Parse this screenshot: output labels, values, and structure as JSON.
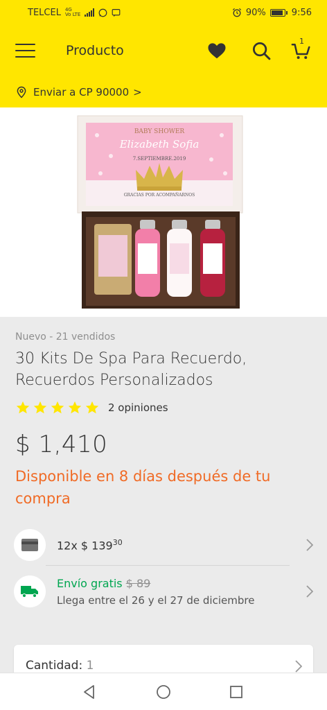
{
  "status_bar": {
    "carrier": "TELCEL",
    "network_top": "Vo LTE",
    "network_gen": "4G",
    "battery": "90%",
    "time": "9:56",
    "icons": [
      "signal-bars",
      "whatsapp",
      "chat",
      "alarm-clock",
      "battery"
    ]
  },
  "app_bar": {
    "title": "Producto",
    "cart_count": "1",
    "icons": [
      "menu-icon",
      "heart-icon",
      "search-icon",
      "cart-icon"
    ]
  },
  "shipping_bar": {
    "label": "Enviar a CP 90000",
    "chevron": ">"
  },
  "product": {
    "condition": "Nuevo - 21 vendidos",
    "title": "30 Kits De Spa Para Recuerdo, Recuerdos Personalizados",
    "rating": 5,
    "rating_max": 5,
    "reviews": "2 opiniones",
    "price": "$ 1,410",
    "availability": "Disponible en 8 días después de tu compra",
    "image_text": {
      "header": "BABY SHOWER",
      "name": "Elizabeth Sofia",
      "date": "7.SEPTIEMBRE.2019",
      "footer": "GRACIAS POR ACOMPAÑARNOS"
    }
  },
  "installments": {
    "prefix": "12x $ 139",
    "cents": "30"
  },
  "shipping": {
    "label": "Envío gratis",
    "old_price": "$ 89",
    "eta": "Llega entre el 26 y el 27 de diciembre"
  },
  "quantity": {
    "label": "Cantidad:",
    "value": "1"
  },
  "colors": {
    "brand_yellow": "#ffe600",
    "availability_orange": "#f06b26",
    "free_shipping_green": "#00a650",
    "star_yellow": "#ffe600"
  }
}
